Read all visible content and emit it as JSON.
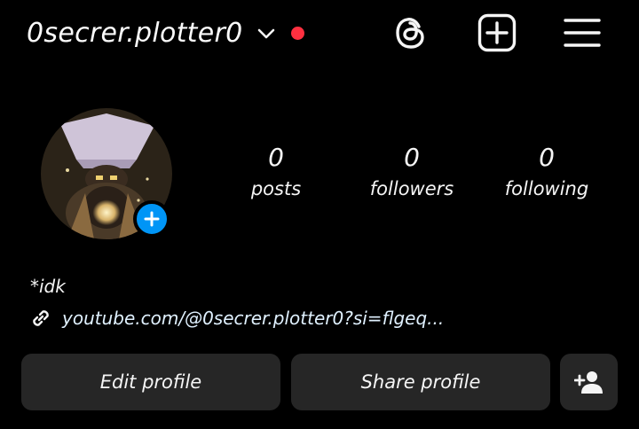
{
  "header": {
    "username": "0secrer.plotter0",
    "has_notification_dot": true,
    "icons": [
      "chevron-down-icon",
      "notification-dot",
      "threads-icon",
      "create-plus-icon",
      "menu-icon"
    ],
    "notification_color": "#ff3040"
  },
  "stats": [
    {
      "count": "0",
      "label": "posts"
    },
    {
      "count": "0",
      "label": "followers"
    },
    {
      "count": "0",
      "label": "following"
    }
  ],
  "bio": {
    "text": "*idk",
    "link_text": "youtube.com/@0secrer.plotter0?si=flgeq..."
  },
  "buttons": {
    "edit_profile": "Edit profile",
    "share_profile": "Share profile",
    "discover_people_icon": "add-person-icon"
  },
  "colors": {
    "background": "#000000",
    "button_bg": "#262626",
    "accent_blue": "#0095f6"
  }
}
